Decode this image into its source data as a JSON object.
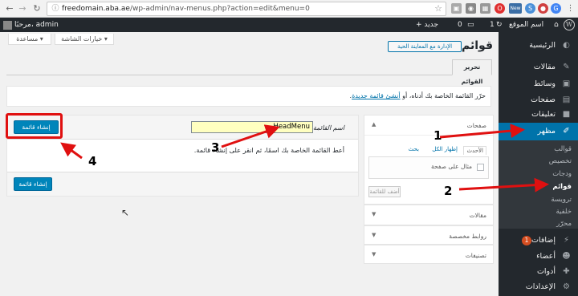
{
  "browser": {
    "url_host": "freedomain.aba.ae",
    "url_path": "/wp-admin/nav-menus.php?action=edit&menu=0",
    "back_icon": "arrow-left-icon",
    "forward_icon": "arrow-right-icon",
    "reload_icon": "reload-icon",
    "ext_badge": "New"
  },
  "adminbar": {
    "greeting": "مرحبًا، admin",
    "site_name": "اسم الموقع",
    "comments_count": "1",
    "new_count": "0",
    "new_label": "+ جديد"
  },
  "top_buttons": {
    "screen_options": "خيارات الشاشة ▾",
    "help": "مساعدة ▾"
  },
  "page": {
    "title": "قوائم",
    "manage_button": "الإدارة مع المعاينة الحية",
    "tab_edit": "تحرير القوائم",
    "instruction_prefix": "حرّر القائمة الخاصة بك أدناه، أو",
    "instruction_link": "أنشئ قائمة جديدة",
    "instruction_suffix": "."
  },
  "sidebar": {
    "items": [
      {
        "label": "الرئيسية",
        "icon": "dashboard-icon"
      },
      {
        "label": "مقالات",
        "icon": "pin-icon"
      },
      {
        "label": "وسائط",
        "icon": "media-icon"
      },
      {
        "label": "صفحات",
        "icon": "page-icon"
      },
      {
        "label": "تعليقات",
        "icon": "comment-icon"
      },
      {
        "label": "مظهر",
        "icon": "brush-icon"
      },
      {
        "label": "إضافات",
        "icon": "plugin-icon",
        "badge": "1"
      },
      {
        "label": "أعضاء",
        "icon": "users-icon"
      },
      {
        "label": "أدوات",
        "icon": "tools-icon"
      },
      {
        "label": "الإعدادات",
        "icon": "settings-icon"
      }
    ],
    "submenu": [
      "قوالب",
      "تخصيص",
      "ودجات",
      "قوائم",
      "ترويسة",
      "خلفية",
      "محرّر"
    ]
  },
  "accordion": {
    "pages_title": "صفحات",
    "tab_recent": "الأحدث",
    "tab_all": "إظهار الكل",
    "tab_search": "بحث",
    "sample_page": "مثال على صفحة",
    "add_button": "أضف للقائمة",
    "links_title": "مقالات",
    "custom_links_title": "روابط مخصصة",
    "categories_title": "تصنيفات"
  },
  "editor": {
    "name_label": "اسم القائمة",
    "name_value": "HeadMenu",
    "create_button": "إنشاء قائمة",
    "help_text": "أعط القائمة الخاصة بك اسمًا، ثم انقر على إنشاء قائمة."
  },
  "annotations": {
    "n1": "1",
    "n2": "2",
    "n3": "3",
    "n4": "4",
    "color": "#e01010"
  }
}
